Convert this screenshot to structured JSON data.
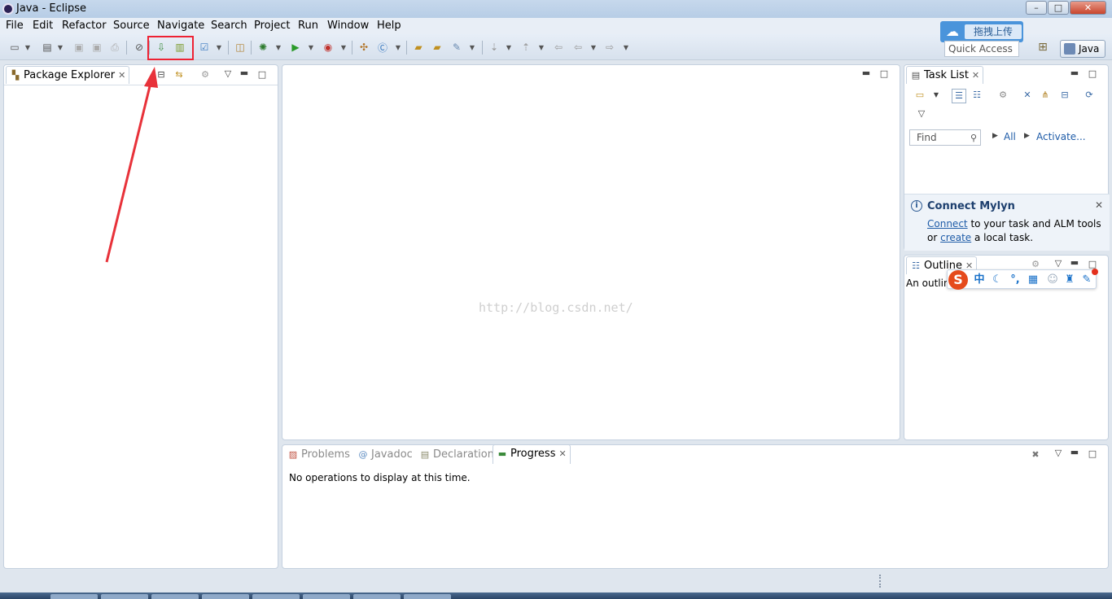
{
  "window": {
    "title": "Java - Eclipse"
  },
  "menu": [
    "File",
    "Edit",
    "Refactor",
    "Source",
    "Navigate",
    "Search",
    "Project",
    "Run",
    "Window",
    "Help"
  ],
  "toolbar": {
    "quick_access": "Quick Access",
    "perspective": "Java",
    "cloud_upload_label": "拖拽上传"
  },
  "package_explorer": {
    "tab_label": "Package Explorer"
  },
  "task_list": {
    "tab_label": "Task List",
    "find_placeholder": "Find",
    "all_label": "All",
    "activate_label": "Activate..."
  },
  "mylyn": {
    "title": "Connect Mylyn",
    "connect_link": "Connect",
    "line1_rest": " to your task and ALM tools",
    "line2_prefix": "or ",
    "create_link": "create",
    "line2_rest": " a local task."
  },
  "outline": {
    "tab_label": "Outline",
    "message": "An outline"
  },
  "bottom": {
    "tabs": [
      "Problems",
      "Javadoc",
      "Declaration",
      "Progress"
    ],
    "active_tab": "Progress",
    "message": "No operations to display at this time."
  },
  "ime": {
    "logo": "S",
    "mode": "中"
  },
  "watermark": "http://blog.csdn.net/",
  "colors": {
    "highlight": "#e22233",
    "link": "#1f5ca8"
  }
}
